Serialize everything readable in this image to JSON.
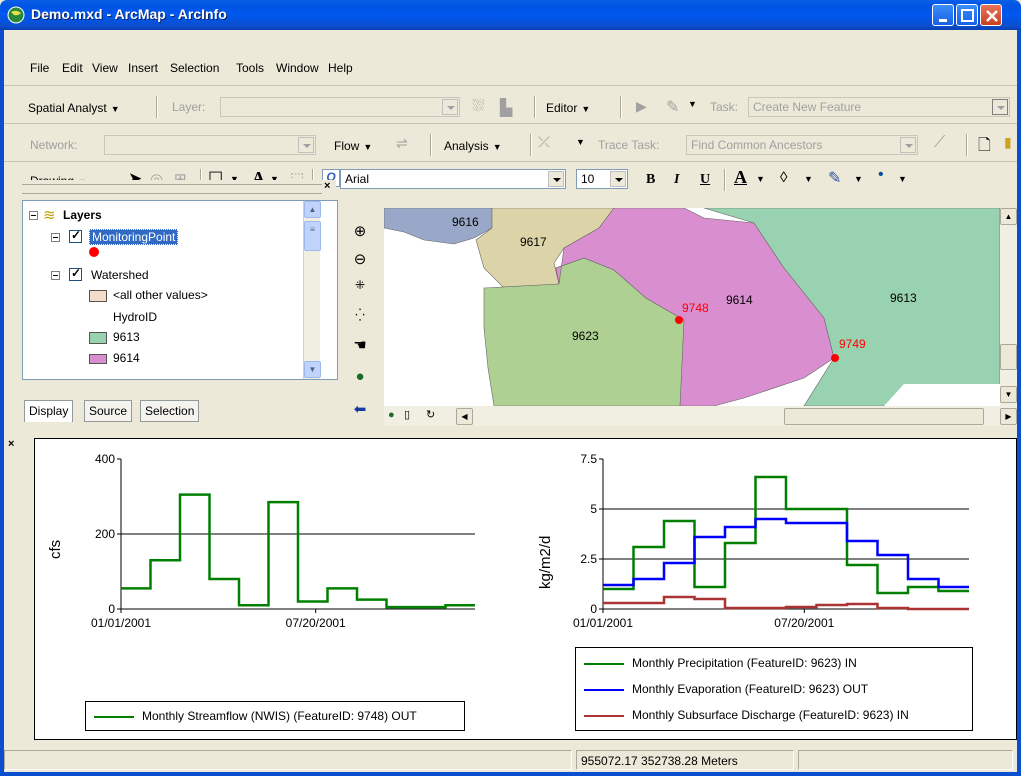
{
  "window": {
    "title": "Demo.mxd - ArcMap - ArcInfo"
  },
  "menu": [
    "File",
    "Edit",
    "View",
    "Insert",
    "Selection",
    "Tools",
    "Window",
    "Help"
  ],
  "toolbar_spatial": {
    "spatial_analyst": "Spatial Analyst",
    "layer_label": "Layer:",
    "editor": "Editor",
    "task_label": "Task:",
    "task_value": "Create New Feature"
  },
  "toolbar_network": {
    "network_label": "Network:",
    "flow": "Flow",
    "analysis": "Analysis",
    "trace_task_label": "Trace Task:",
    "trace_task_value": "Find Common Ancestors"
  },
  "toolbar_drawing": {
    "drawing": "Drawing",
    "font_name": "Arial",
    "font_size": "10",
    "bold": "B",
    "italic": "I",
    "underline": "U",
    "font_color": "A"
  },
  "toc": {
    "root": "Layers",
    "layers": [
      {
        "name": "MonitoringPoint",
        "selected": true
      },
      {
        "name": "Watershed"
      }
    ],
    "legend_items": [
      {
        "label": "<all other values>",
        "color": "#f6dcc8"
      },
      {
        "label": "HydroID",
        "color": ""
      },
      {
        "label": "9613",
        "color": "#99d2b0"
      },
      {
        "label": "9614",
        "color": "#d98fcf"
      }
    ],
    "tabs": [
      "Display",
      "Source",
      "Selection"
    ]
  },
  "map": {
    "polygons": [
      {
        "id": "9616",
        "color": "#99a8c8"
      },
      {
        "id": "9617",
        "color": "#dcd4a8"
      },
      {
        "id": "9614",
        "color": "#d98fcf"
      },
      {
        "id": "9613",
        "color": "#99d2b0"
      },
      {
        "id": "9623",
        "color": "#aed093"
      }
    ],
    "points": [
      {
        "id": "9748",
        "color": "#ff0000"
      },
      {
        "id": "9749",
        "color": "#ff0000"
      }
    ]
  },
  "status": {
    "coords": "955072.17  352738.28 Meters"
  },
  "chart_data": [
    {
      "type": "line",
      "step": true,
      "title": "",
      "ylabel": "cfs",
      "ylim": [
        0,
        400
      ],
      "yticks": [
        "0",
        "200",
        "400"
      ],
      "xticks": [
        "01/01/2001",
        "07/20/2001"
      ],
      "x_start": "2001-01-01",
      "series": [
        {
          "name": "Monthly Streamflow (NWIS) (FeatureID: 9748) OUT",
          "color": "#008000",
          "values": [
            55,
            130,
            305,
            80,
            10,
            285,
            20,
            55,
            25,
            5,
            5,
            10
          ]
        }
      ]
    },
    {
      "type": "line",
      "step": true,
      "title": "",
      "ylabel": "kg/m2/d",
      "ylim": [
        0,
        7.5
      ],
      "yticks": [
        "0",
        "2.5",
        "5",
        "7.5"
      ],
      "xticks": [
        "01/01/2001",
        "07/20/2001"
      ],
      "x_start": "2001-01-01",
      "series": [
        {
          "name": "Monthly Precipitation (FeatureID: 9623) IN",
          "color": "#008000",
          "values": [
            1.0,
            3.1,
            4.4,
            1.1,
            3.3,
            6.6,
            5.0,
            5.0,
            2.2,
            0.8,
            1.1,
            0.9
          ]
        },
        {
          "name": "Monthly Evaporation (FeatureID: 9623) OUT",
          "color": "#0000ff",
          "values": [
            1.2,
            1.5,
            2.3,
            3.6,
            4.1,
            4.5,
            4.3,
            4.3,
            3.4,
            2.7,
            1.5,
            1.1
          ]
        },
        {
          "name": "Monthly Subsurface Discharge (FeatureID: 9623) IN",
          "color": "#aa3333",
          "values": [
            0.3,
            0.3,
            0.6,
            0.5,
            0.05,
            0.05,
            0.1,
            0.2,
            0.25,
            0.05,
            0.0,
            0.0
          ]
        }
      ]
    }
  ]
}
